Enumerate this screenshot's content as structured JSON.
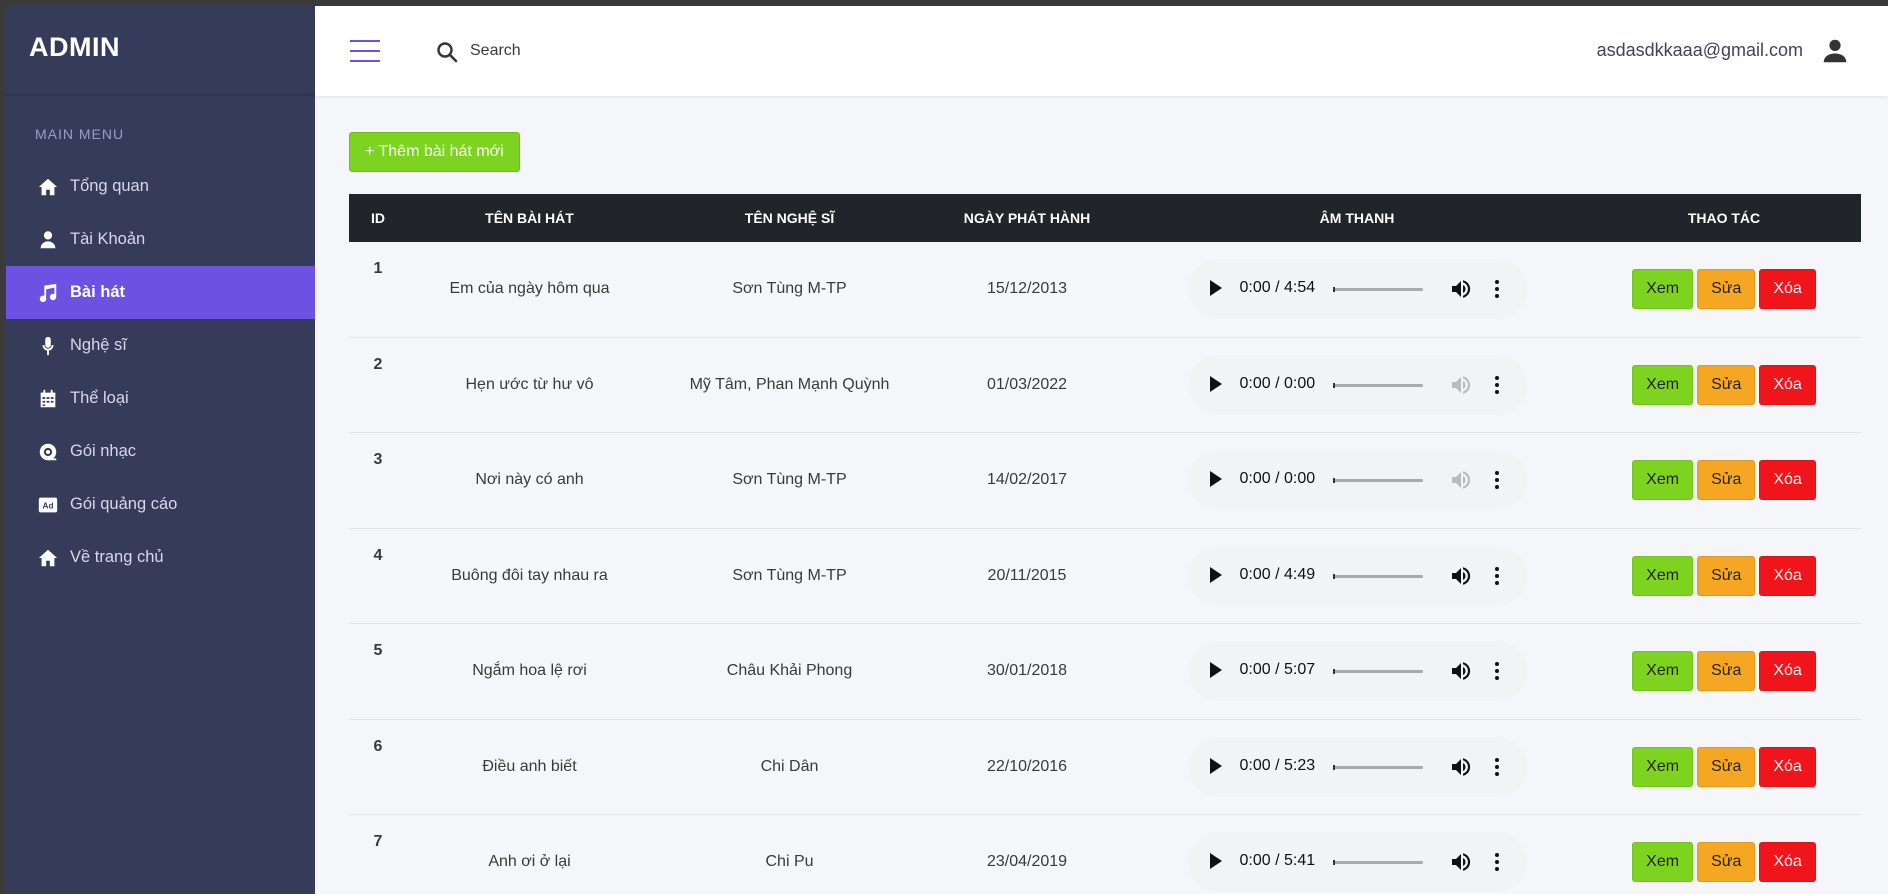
{
  "sidebar": {
    "brand": "ADMIN",
    "menu_title": "MAIN MENU",
    "items": [
      {
        "label": "Tổng quan",
        "icon": "home-icon"
      },
      {
        "label": "Tài Khoản",
        "icon": "user-icon"
      },
      {
        "label": "Bài hát",
        "icon": "music-note-icon",
        "active": true
      },
      {
        "label": "Nghệ sĩ",
        "icon": "microphone-icon"
      },
      {
        "label": "Thể loại",
        "icon": "calendar-icon"
      },
      {
        "label": "Gói nhạc",
        "icon": "disc-icon"
      },
      {
        "label": "Gói quảng cáo",
        "icon": "ad-icon"
      },
      {
        "label": "Về trang chủ",
        "icon": "home-icon"
      }
    ]
  },
  "header": {
    "search_placeholder": "Search",
    "user_email": "asdasdkkaaa@gmail.com"
  },
  "content": {
    "add_button": "+ Thêm bài hát mới",
    "columns": [
      "ID",
      "TÊN BÀI HÁT",
      "TÊN NGHỆ SĨ",
      "NGÀY PHÁT HÀNH",
      "ÂM THANH",
      "THAO TÁC"
    ],
    "rows": [
      {
        "id": "1",
        "name": "Em của ngày hôm qua",
        "artist": "Sơn Tùng M-TP",
        "date": "15/12/2013",
        "time": "0:00 / 4:54",
        "muted": false
      },
      {
        "id": "2",
        "name": "Hẹn ước từ hư vô",
        "artist": "Mỹ Tâm, Phan Mạnh Quỳnh",
        "date": "01/03/2022",
        "time": "0:00 / 0:00",
        "muted": true
      },
      {
        "id": "3",
        "name": "Nơi này có anh",
        "artist": "Sơn Tùng M-TP",
        "date": "14/02/2017",
        "time": "0:00 / 0:00",
        "muted": true
      },
      {
        "id": "4",
        "name": "Buông đôi tay nhau ra",
        "artist": "Sơn Tùng M-TP",
        "date": "20/11/2015",
        "time": "0:00 / 4:49",
        "muted": false
      },
      {
        "id": "5",
        "name": "Ngắm hoa lệ rơi",
        "artist": "Châu Khải Phong",
        "date": "30/01/2018",
        "time": "0:00 / 5:07",
        "muted": false
      },
      {
        "id": "6",
        "name": "Điều anh biết",
        "artist": "Chi Dân",
        "date": "22/10/2016",
        "time": "0:00 / 5:23",
        "muted": false
      },
      {
        "id": "7",
        "name": "Anh ơi ở lại",
        "artist": "Chi Pu",
        "date": "23/04/2019",
        "time": "0:00 / 5:41",
        "muted": false
      }
    ],
    "actions": {
      "view": "Xem",
      "edit": "Sửa",
      "delete": "Xóa"
    }
  },
  "colors": {
    "sidebar_bg": "#363b59",
    "accent": "#6b52e3",
    "view_btn": "#7ed321",
    "edit_btn": "#f5a623",
    "delete_btn": "#f0151b",
    "table_header": "#212529"
  }
}
